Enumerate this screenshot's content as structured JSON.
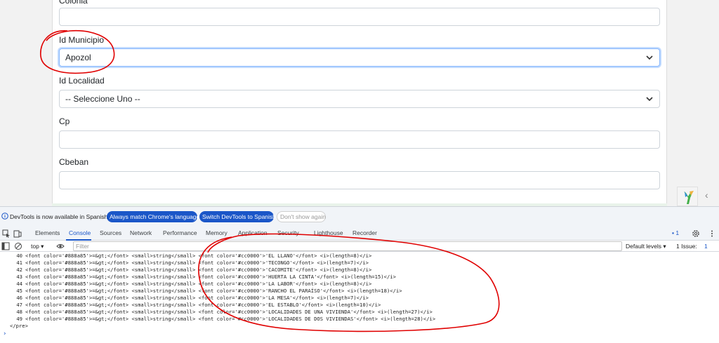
{
  "form": {
    "partial_label": "Colonia",
    "fields": [
      {
        "label": "Id Municipio",
        "value": "Apozol",
        "type": "select"
      },
      {
        "label": "Id Localidad",
        "value": "-- Seleccione Uno --",
        "type": "select"
      },
      {
        "label": "Cp",
        "value": "",
        "type": "text"
      },
      {
        "label": "Cbeban",
        "value": "",
        "type": "text"
      }
    ]
  },
  "devtools": {
    "info_text": "DevTools is now available in Spanish!",
    "btn_always_match": "Always match Chrome's language",
    "btn_switch": "Switch DevTools to Spanish",
    "btn_dont_show": "Don't show again",
    "tabs": [
      "Elements",
      "Console",
      "Sources",
      "Network",
      "Performance",
      "Memory",
      "Application",
      "Security",
      "Lighthouse",
      "Recorder"
    ],
    "active_tab": "Console",
    "issues_badge": "1",
    "context": "top ▾",
    "filter_placeholder": "Filter",
    "levels": "Default levels ▾",
    "issue_label": "1 Issue:",
    "issue_count": "1",
    "lines": [
      {
        "n": "40",
        "text": "<font color='#888a85'>=&gt;</font> <small>string</small> <font color='#cc0000'>'EL LLANO'</font> <i>(length=8)</i>"
      },
      {
        "n": "41",
        "text": "<font color='#888a85'>=&gt;</font> <small>string</small> <font color='#cc0000'>'TECONGO'</font> <i>(length=7)</i>"
      },
      {
        "n": "42",
        "text": "<font color='#888a85'>=&gt;</font> <small>string</small> <font color='#cc0000'>'CACOMITE'</font> <i>(length=8)</i>"
      },
      {
        "n": "43",
        "text": "<font color='#888a85'>=&gt;</font> <small>string</small> <font color='#cc0000'>'HUERTA LA CINTA'</font> <i>(length=15)</i>"
      },
      {
        "n": "44",
        "text": "<font color='#888a85'>=&gt;</font> <small>string</small> <font color='#cc0000'>'LA LABOR'</font> <i>(length=8)</i>"
      },
      {
        "n": "45",
        "text": "<font color='#888a85'>=&gt;</font> <small>string</small> <font color='#cc0000'>'RANCHO EL PARAÍSO'</font> <i>(length=18)</i>"
      },
      {
        "n": "46",
        "text": "<font color='#888a85'>=&gt;</font> <small>string</small> <font color='#cc0000'>'LA MESA'</font> <i>(length=7)</i>"
      },
      {
        "n": "47",
        "text": "<font color='#888a85'>=&gt;</font> <small>string</small> <font color='#cc0000'>'EL ESTABLO'</font> <i>(length=10)</i>"
      },
      {
        "n": "48",
        "text": "<font color='#888a85'>=&gt;</font> <small>string</small> <font color='#cc0000'>'LOCALIDADES DE UNA VIVIENDA'</font> <i>(length=27)</i>"
      },
      {
        "n": "49",
        "text": "<font color='#888a85'>=&gt;</font> <small>string</small> <font color='#cc0000'>'LOCALIDADES DE DOS VIVIENDAS'</font> <i>(length=28)</i>"
      }
    ],
    "closing": "</pre>",
    "prompt": "›"
  },
  "colors": {
    "accent": "#1a56c8",
    "annotation": "#e00000"
  }
}
